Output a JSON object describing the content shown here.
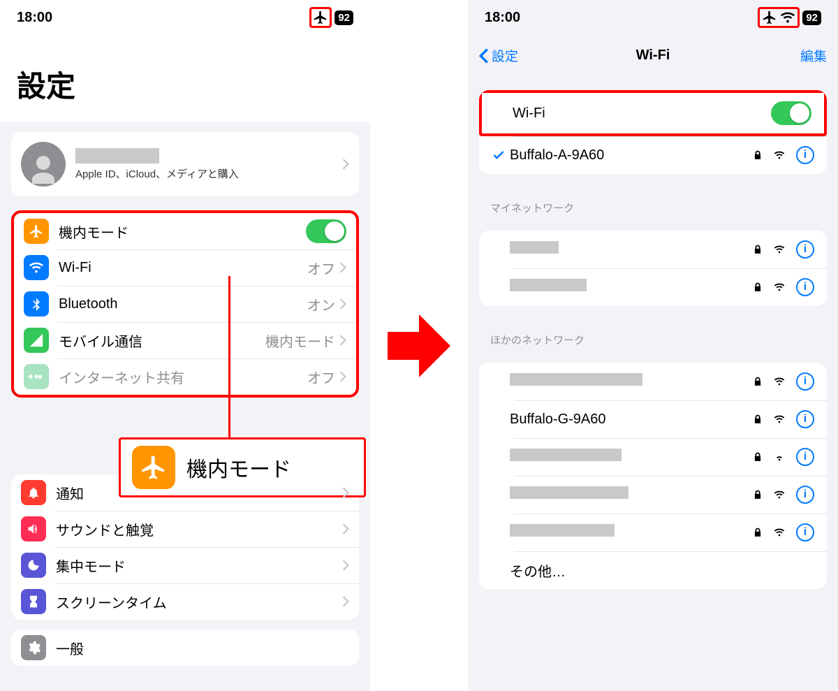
{
  "status": {
    "time": "18:00",
    "battery": "92"
  },
  "left": {
    "title": "設定",
    "profile_sub": "Apple ID、iCloud、メディアと購入",
    "rows": {
      "airplane": "機内モード",
      "wifi": "Wi-Fi",
      "wifi_val": "オフ",
      "bluetooth": "Bluetooth",
      "bluetooth_val": "オン",
      "mobile": "モバイル通信",
      "mobile_val": "機内モード",
      "hotspot": "インターネット共有",
      "hotspot_val": "オフ",
      "notifications": "通知",
      "sound": "サウンドと触覚",
      "focus": "集中モード",
      "screentime": "スクリーンタイム",
      "general": "一般"
    },
    "callout_label": "機内モード"
  },
  "right": {
    "back": "設定",
    "title": "Wi-Fi",
    "edit": "編集",
    "wifi_label": "Wi-Fi",
    "connected": "Buffalo-A-9A60",
    "section_my": "マイネットワーク",
    "section_other": "ほかのネットワーク",
    "other_known": "Buffalo-G-9A60",
    "other_label": "その他…"
  }
}
